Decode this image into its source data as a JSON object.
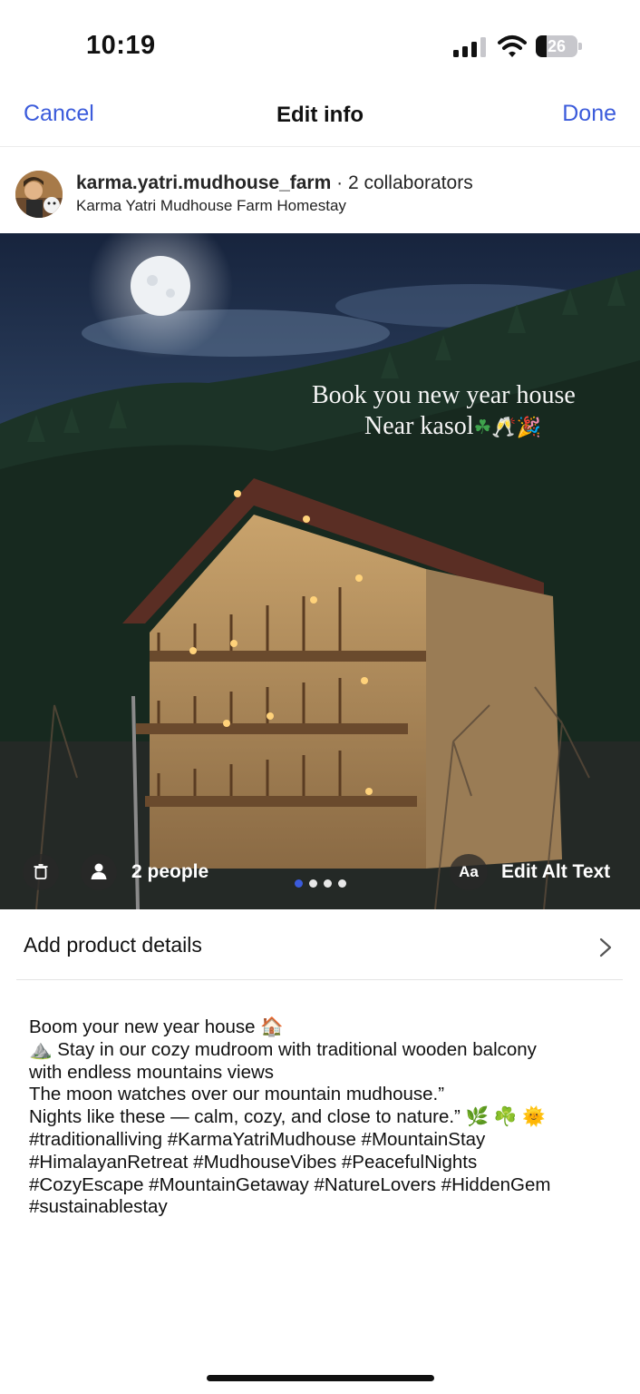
{
  "status_bar": {
    "time": "10:19",
    "battery_level": "26",
    "battery_fraction": 0.26
  },
  "nav": {
    "cancel_label": "Cancel",
    "title": "Edit info",
    "done_label": "Done",
    "accent_color": "#3b5bdb"
  },
  "author": {
    "username": "karma.yatri.mudhouse_farm",
    "collaborators": "· 2 collaborators",
    "location": "Karma Yatri Mudhouse Farm Homestay"
  },
  "photo": {
    "overlay_line1": "Book you new  year house",
    "overlay_line2": "Near kasol",
    "overlay_emojis": [
      "clover",
      "clinking-glasses",
      "party-popper"
    ],
    "people_label": "2 people",
    "alt_icon_label": "Aa",
    "alt_label": "Edit Alt Text",
    "carousel_total": 4,
    "carousel_active": 1
  },
  "product": {
    "label": "Add product details"
  },
  "caption": {
    "lines": [
      "Boom your  new year house 🏠",
      "⛰️ Stay in our cozy mudroom with traditional wooden balcony",
      "with endless mountains views",
      "The moon watches over our mountain mudhouse.”",
      "Nights like these — calm, cozy, and close to nature.” 🌿 ☘️ 🌞",
      "#traditionalliving #KarmaYatriMudhouse #MountainStay",
      "#HimalayanRetreat #MudhouseVibes #PeacefulNights",
      "#CozyEscape #MountainGetaway #NatureLovers #HiddenGem",
      "#sustainablestay"
    ]
  }
}
